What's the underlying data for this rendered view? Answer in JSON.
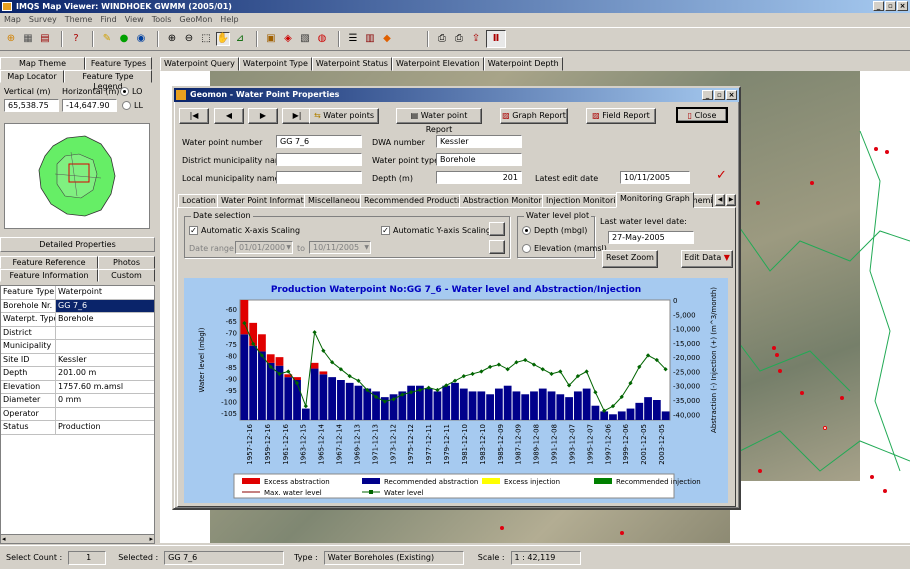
{
  "app": {
    "title": "IMQS Map Viewer: WINDHOEK GWMM (2005/01)"
  },
  "menu": [
    "Map",
    "Survey",
    "Theme",
    "Find",
    "View",
    "Tools",
    "GeoMon",
    "Help"
  ],
  "left": {
    "tabs_top": [
      "Map Theme Legend",
      "Feature Types"
    ],
    "tabs_bottom": [
      "Map Locator",
      "Feature Type Legend"
    ],
    "vertical_label": "Vertical (m)",
    "horizontal_label": "Horizontal (m)",
    "vertical_value": "65,538.75",
    "horizontal_value": "-14,647.90",
    "radio_lo": "LO",
    "radio_ll": "LL",
    "detailed_props": "Detailed Properties",
    "sub_tabs": [
      "Feature Reference",
      "Photos",
      "Feature Information",
      "Custom"
    ],
    "props": [
      {
        "k": "Feature Type:",
        "v": "Waterpoint"
      },
      {
        "k": "Borehole Nr.",
        "v": "GG 7_6"
      },
      {
        "k": "Waterpt. Type",
        "v": "Borehole"
      },
      {
        "k": "District",
        "v": ""
      },
      {
        "k": "Municipality",
        "v": ""
      },
      {
        "k": "Site ID",
        "v": "Kessler"
      },
      {
        "k": "Depth",
        "v": "201.00 m"
      },
      {
        "k": "Elevation",
        "v": "1757.60 m.amsl"
      },
      {
        "k": "Diameter",
        "v": "0 mm"
      },
      {
        "k": "Operator",
        "v": ""
      },
      {
        "k": "Status",
        "v": "Production"
      }
    ]
  },
  "map_tabs": [
    "Waterpoint Query",
    "Waterpoint Type",
    "Waterpoint Status",
    "Waterpoint Elevation",
    "Waterpoint Depth"
  ],
  "dialog": {
    "title": "Geomon - Water Point Properties",
    "nav": [
      "|◀",
      "◀",
      "▶",
      "▶|"
    ],
    "buttons": {
      "water_points": "Water points",
      "report": "Water point Report",
      "graph": "Graph Report",
      "field": "Field Report",
      "close": "Close"
    },
    "labels": {
      "wp_number": "Water point number",
      "dwa": "DWA number",
      "district": "District municipality name",
      "wp_type": "Water point type",
      "local": "Local municipality name",
      "depth": "Depth (m)",
      "latest": "Latest edit date"
    },
    "values": {
      "wp_number": "GG 7_6",
      "dwa": "Kessler",
      "district": "",
      "wp_type": "Borehole",
      "local": "",
      "depth": "201",
      "latest": "10/11/2005"
    },
    "tabs": [
      "Location",
      "Water Point Information",
      "Miscellaneous",
      "Recommended Production",
      "Abstraction Monitoring",
      "Injection Monitoring",
      "Monitoring Graph",
      "Chemical"
    ],
    "date_group": "Date selection",
    "auto_x": "Automatic X-axis Scaling",
    "auto_y": "Automatic Y-axis Scaling...",
    "date_range": "Date range",
    "date_from": "01/01/2000",
    "date_to_label": "to",
    "date_to": "10/11/2005",
    "wl_group": "Water level plot",
    "depth_opt": "Depth (mbgl)",
    "elev_opt": "Elevation (mamsl)",
    "last_wl_label": "Last water level date:",
    "last_wl": "27-May-2005",
    "reset_zoom": "Reset Zoom",
    "edit_data": "Edit Data"
  },
  "chart_data": {
    "type": "bar",
    "title": "Production Waterpoint No:GG 7_6 - Water level and Abstraction/Injection",
    "ylabel_left": "Water level (mbgl)",
    "ylabel_right": "Abstraction (-) Injection (+) (m^3/month)",
    "y_left_ticks": [
      "-60",
      "-65",
      "-70",
      "-75",
      "-80",
      "-85",
      "-90",
      "-95",
      "-100",
      "-105"
    ],
    "y_right_ticks": [
      "-40,000",
      "-35,000",
      "-30,000",
      "-25,000",
      "-20,000",
      "-15,000",
      "-10,000",
      "-5,000",
      "0"
    ],
    "x_ticks": [
      "1957-12-16",
      "1959-12-16",
      "1961-12-16",
      "1963-12-15",
      "1965-12-14",
      "1967-12-14",
      "1969-12-13",
      "1971-12-13",
      "1973-12-12",
      "1975-12-12",
      "1977-12-11",
      "1979-12-11",
      "1981-12-10",
      "1983-12-10",
      "1985-12-09",
      "1987-12-09",
      "1989-12-08",
      "1991-12-08",
      "1993-12-07",
      "1995-12-07",
      "1997-12-06",
      "1999-12-06",
      "2001-12-05",
      "2003-12-05"
    ],
    "ylim_left": [
      -108,
      -56
    ],
    "ylim_right": [
      -42000,
      0
    ],
    "legend": [
      "Excess abstraction",
      "Recommended abstraction",
      "Excess injection",
      "Recommended injection",
      "Max. water level",
      "Water level"
    ],
    "series_colors": {
      "excess_abs": "#e00000",
      "rec_abs": "#00008b",
      "excess_inj": "#ffff00",
      "rec_inj": "#008000",
      "max_wl": "#8b0000",
      "wl": "#006400"
    },
    "x_years": [
      1957,
      1958,
      1959,
      1960,
      1961,
      1962,
      1963,
      1964,
      1965,
      1966,
      1967,
      1968,
      1969,
      1970,
      1971,
      1972,
      1973,
      1974,
      1975,
      1976,
      1977,
      1978,
      1979,
      1980,
      1981,
      1982,
      1983,
      1984,
      1985,
      1986,
      1987,
      1988,
      1989,
      1990,
      1991,
      1992,
      1993,
      1994,
      1995,
      1996,
      1997,
      1998,
      1999,
      2000,
      2001,
      2002,
      2003,
      2004,
      2005
    ],
    "abstraction": [
      -30000,
      -26000,
      -24000,
      -20000,
      -19000,
      -15000,
      -14000,
      -4000,
      -18000,
      -16000,
      -15000,
      -14000,
      -13000,
      -12000,
      -11000,
      -10000,
      -8000,
      -9000,
      -10000,
      -12000,
      -12000,
      -11000,
      -10000,
      -12000,
      -13000,
      -11000,
      -10000,
      -10000,
      -9000,
      -11000,
      -12000,
      -10000,
      -9000,
      -10000,
      -11000,
      -10000,
      -9000,
      -8000,
      -10000,
      -11000,
      -5000,
      -3000,
      -2000,
      -3000,
      -4000,
      -6000,
      -8000,
      -7000,
      -3000
    ],
    "excess": [
      -12000,
      -8000,
      -6000,
      -3000,
      -3000,
      -1000,
      -1000,
      0,
      -2000,
      -1000,
      0,
      0,
      0,
      0,
      0,
      0,
      0,
      0,
      0,
      0,
      0,
      0,
      0,
      0,
      0,
      0,
      0,
      0,
      0,
      0,
      0,
      0,
      0,
      0,
      0,
      0,
      0,
      0,
      0,
      0,
      0,
      0,
      0,
      0,
      0,
      0,
      0,
      0,
      0
    ],
    "water_level": [
      -66,
      -75,
      -80,
      -85,
      -88,
      -87,
      -92,
      -102,
      -70,
      -78,
      -83,
      -86,
      -89,
      -91,
      -95,
      -98,
      -100,
      -99,
      -97,
      -96,
      -95,
      -94,
      -95,
      -93,
      -91,
      -89,
      -88,
      -87,
      -85,
      -84,
      -86,
      -83,
      -82,
      -84,
      -86,
      -88,
      -87,
      -93,
      -89,
      -87,
      -96,
      -104,
      -102,
      -98,
      -92,
      -85,
      -80,
      -82,
      -86
    ]
  },
  "status": {
    "select_count_label": "Select Count :",
    "select_count": "1",
    "selected_label": "Selected :",
    "selected": "GG 7_6",
    "type_label": "Type :",
    "type": "Water Boreholes (Existing)",
    "scale_label": "Scale :",
    "scale": "1 : 42,119"
  }
}
